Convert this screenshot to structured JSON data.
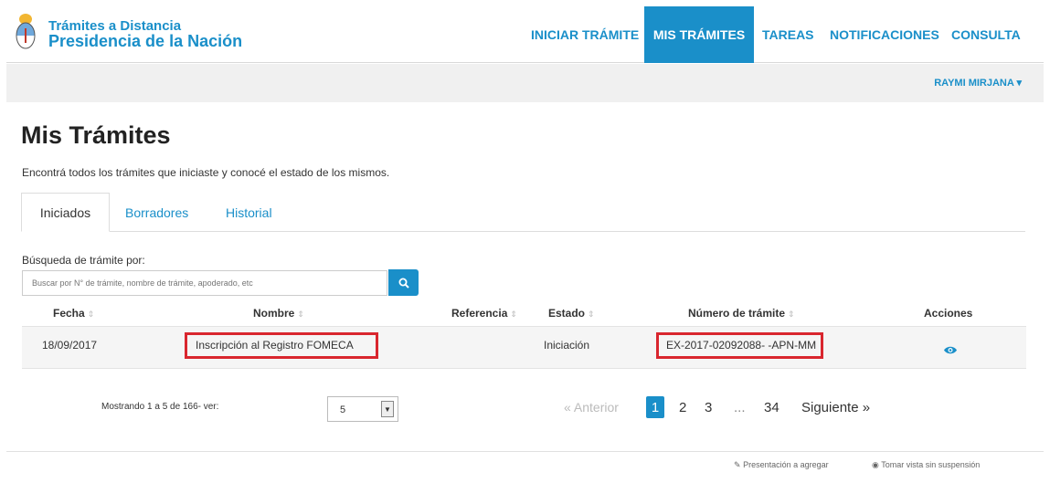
{
  "header": {
    "brand_line1": "Trámites a Distancia",
    "brand_line2": "Presidencia de la Nación",
    "nav": [
      {
        "label": "INICIAR TRÁMITE"
      },
      {
        "label": "MIS TRÁMITES",
        "active": true
      },
      {
        "label": "TAREAS"
      },
      {
        "label": "NOTIFICACIONES"
      },
      {
        "label": "CONSULTA"
      }
    ],
    "user": "RAYMI MIRJANA",
    "user_caret": "▾"
  },
  "page": {
    "title": "Mis Trámites",
    "description": "Encontrá todos los trámites que iniciaste y conocé el estado de los mismos."
  },
  "tabs": [
    {
      "label": "Iniciados",
      "active": true
    },
    {
      "label": "Borradores"
    },
    {
      "label": "Historial"
    }
  ],
  "search": {
    "label": "Búsqueda de trámite por:",
    "placeholder": "Buscar por N° de trámite, nombre de trámite, apoderado, etc",
    "icon": "search-icon"
  },
  "table": {
    "columns": [
      "Fecha",
      "Nombre",
      "Referencia",
      "Estado",
      "Número de trámite",
      "Acciones"
    ],
    "sort_glyph": "⇕",
    "rows": [
      {
        "fecha": "18/09/2017",
        "nombre": "Inscripción al Registro FOMECA",
        "referencia": "",
        "estado": "Iniciación",
        "numero": "EX-2017-02092088- -APN-MM",
        "accion_icon": "eye-icon"
      }
    ]
  },
  "pagination": {
    "showing": "Mostrando 1 a 5 de 166- ver:",
    "page_size": "5",
    "prev": "« Anterior",
    "pages": [
      "1",
      "2",
      "3",
      "...",
      "34"
    ],
    "current": "1",
    "next": "Siguiente »"
  },
  "footer": {
    "link1": "Presentación a agregar",
    "link2": "Tomar vista sin suspensión"
  },
  "colors": {
    "accent": "#1a8fc9",
    "highlight": "#d9262e"
  }
}
